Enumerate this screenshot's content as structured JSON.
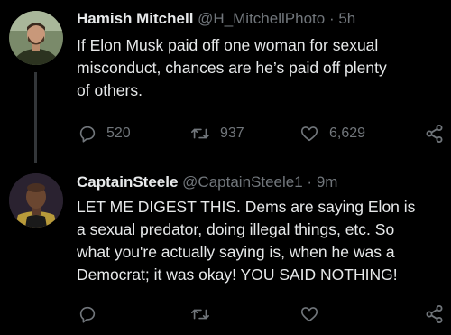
{
  "tweets": [
    {
      "author": {
        "name": "Hamish Mitchell",
        "handle": "@H_MitchellPhoto"
      },
      "separator": "·",
      "time": "5h",
      "text_lines": [
        "If Elon Musk paid off one woman for sexual",
        "misconduct, chances are he’s paid off plenty",
        "of others."
      ],
      "stats": {
        "replies": "520",
        "retweets": "937",
        "likes": "6,629"
      }
    },
    {
      "author": {
        "name": "CaptainSteele",
        "handle": "@CaptainSteele1"
      },
      "separator": "·",
      "time": "9m",
      "text_lines": [
        "LET ME DIGEST THIS. Dems are saying Elon is",
        "a sexual predator, doing illegal things, etc. So",
        "what you're actually saying is, when he was a",
        "Democrat; it was okay! YOU SAID NOTHING!"
      ],
      "stats": {
        "replies": "",
        "retweets": "",
        "likes": ""
      }
    }
  ],
  "icons": {
    "reply": "reply-icon",
    "retweet": "retweet-icon",
    "like": "heart-icon",
    "share": "share-icon"
  },
  "colors": {
    "background": "#000000",
    "text": "#e7e9ea",
    "muted": "#71767b",
    "thread_line": "#333639"
  }
}
